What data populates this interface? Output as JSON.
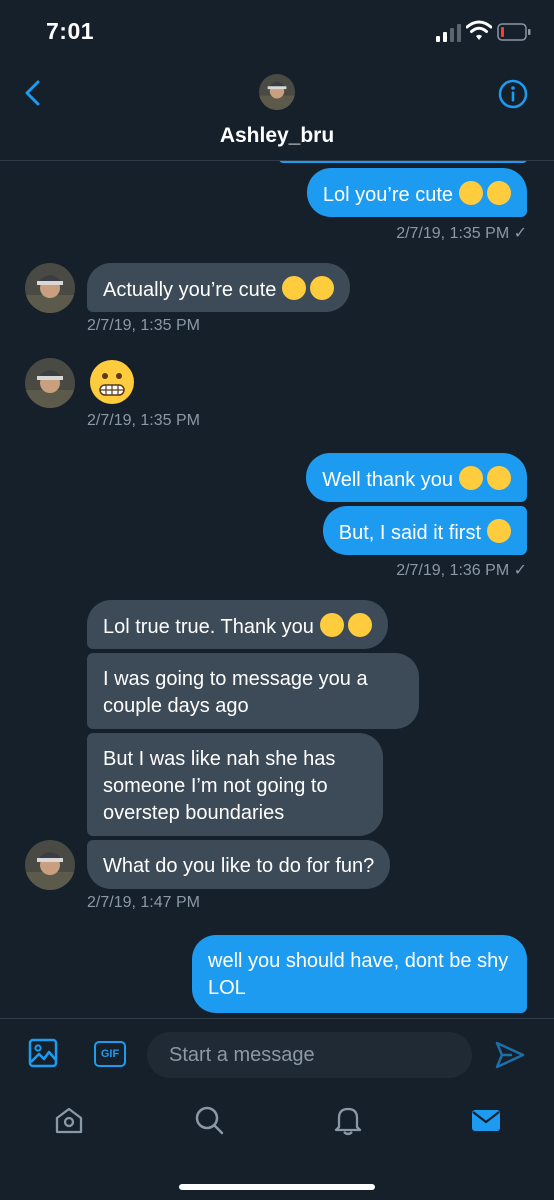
{
  "status_bar": {
    "time": "7:01"
  },
  "header": {
    "contact_name": "Ashley_bru"
  },
  "messages": {
    "m1": "Lol you’re cute",
    "t1": "2/7/19, 1:35 PM ✓",
    "m2": "Actually you’re cute",
    "t2": "2/7/19, 1:35 PM",
    "t3": "2/7/19, 1:35 PM",
    "m4": "Well thank you",
    "m5": "But, I said it first",
    "t5": "2/7/19, 1:36 PM ✓",
    "m6": "Lol true true. Thank you",
    "m7": "I was going to message you a couple days ago",
    "m8": "But I was like nah she has someone I’m not going to overstep boundaries",
    "m9": "What do you like to do for fun?",
    "t9": "2/7/19, 1:47 PM",
    "m10": "well you should have, dont be shy LOL"
  },
  "composer": {
    "placeholder": "Start a message",
    "gif_label": "GIF"
  },
  "tabs": [
    "home",
    "search",
    "notifications",
    "messages"
  ],
  "colors": {
    "background": "#15202b",
    "accent": "#1d9bf0",
    "incoming_bubble": "#3d4a57",
    "muted": "#8b98a5"
  }
}
